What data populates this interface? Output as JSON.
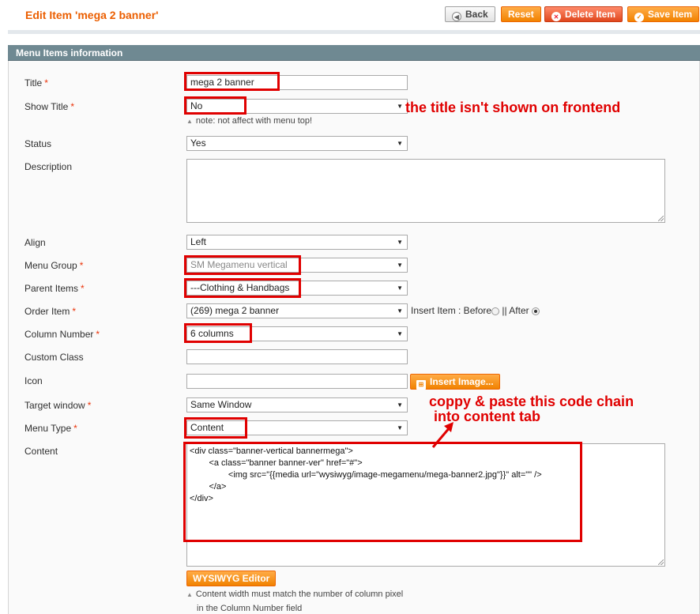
{
  "header": {
    "title": "Edit Item 'mega 2 banner'",
    "back_label": "Back",
    "reset_label": "Reset",
    "delete_label": "Delete Item",
    "save_label": "Save Item"
  },
  "section": {
    "title": "Menu Items information"
  },
  "fields": {
    "title": {
      "label": "Title",
      "value": "mega 2 banner"
    },
    "show_title": {
      "label": "Show Title",
      "value": "No",
      "note": "note: not affect with menu top!"
    },
    "status": {
      "label": "Status",
      "value": "Yes"
    },
    "description": {
      "label": "Description",
      "value": ""
    },
    "align": {
      "label": "Align",
      "value": "Left"
    },
    "menu_group": {
      "label": "Menu Group",
      "value": "SM Megamenu vertical"
    },
    "parent_items": {
      "label": "Parent Items",
      "value": "---Clothing & Handbags"
    },
    "order_item": {
      "label": "Order Item",
      "value": "(269) mega 2 banner",
      "insert_label": "Insert Item : Before",
      "after_label": "|| After"
    },
    "column_number": {
      "label": "Column Number",
      "value": "6 columns"
    },
    "custom_class": {
      "label": "Custom Class",
      "value": ""
    },
    "icon": {
      "label": "Icon",
      "value": "",
      "button_label": "Insert Image..."
    },
    "target_window": {
      "label": "Target window",
      "value": "Same Window"
    },
    "menu_type": {
      "label": "Menu Type",
      "value": "Content"
    },
    "content": {
      "label": "Content",
      "value": "<div class=\"banner-vertical bannermega\">\n        <a class=\"banner banner-ver\" href=\"#\">\n                <img src=\"{{media url=\"wysiwyg/image-megamenu/mega-banner2.jpg\"}}\" alt=\"\" />\n        </a>\n</div>",
      "wysiwyg_label": "WYSIWYG Editor",
      "note_line1": "Content width must match the number of column pixel",
      "note_line2": "in the Column Number field"
    }
  },
  "annotations": {
    "title_note": "the title isn't shown on frontend",
    "copy_line1": "coppy & paste this code chain",
    "copy_line2": "into content tab"
  }
}
